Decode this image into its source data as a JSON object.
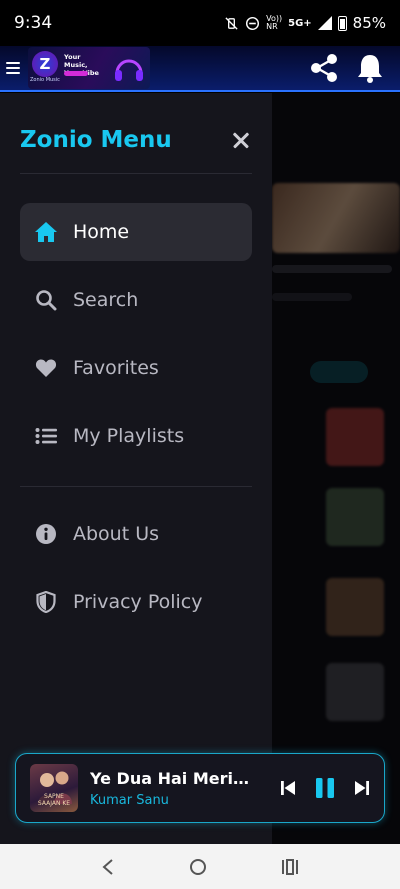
{
  "status_bar": {
    "time": "9:34",
    "network_top": "Vo))",
    "network_bottom": "NR",
    "network_type": "5G+",
    "battery": "85%"
  },
  "header": {
    "banner": {
      "logo_letter": "Z",
      "brand": "Zonio Music",
      "tagline": "Your Music, Your Vibe"
    }
  },
  "drawer": {
    "title": "Zonio Menu",
    "menu_items": [
      {
        "label": "Home",
        "icon": "home-icon",
        "active": true
      },
      {
        "label": "Search",
        "icon": "search-icon",
        "active": false
      },
      {
        "label": "Favorites",
        "icon": "heart-icon",
        "active": false
      },
      {
        "label": "My Playlists",
        "icon": "list-icon",
        "active": false
      }
    ],
    "secondary_items": [
      {
        "label": "About Us",
        "icon": "info-icon"
      },
      {
        "label": "Privacy Policy",
        "icon": "shield-icon"
      }
    ]
  },
  "player": {
    "title": "Ye Dua Hai Meri ...",
    "artist": "Kumar Sanu",
    "album_text": "SAPNE SAAJAN KE"
  },
  "colors": {
    "accent": "#19c8f0",
    "player_border": "#1aa7c9",
    "drawer_bg": "#15151c"
  }
}
